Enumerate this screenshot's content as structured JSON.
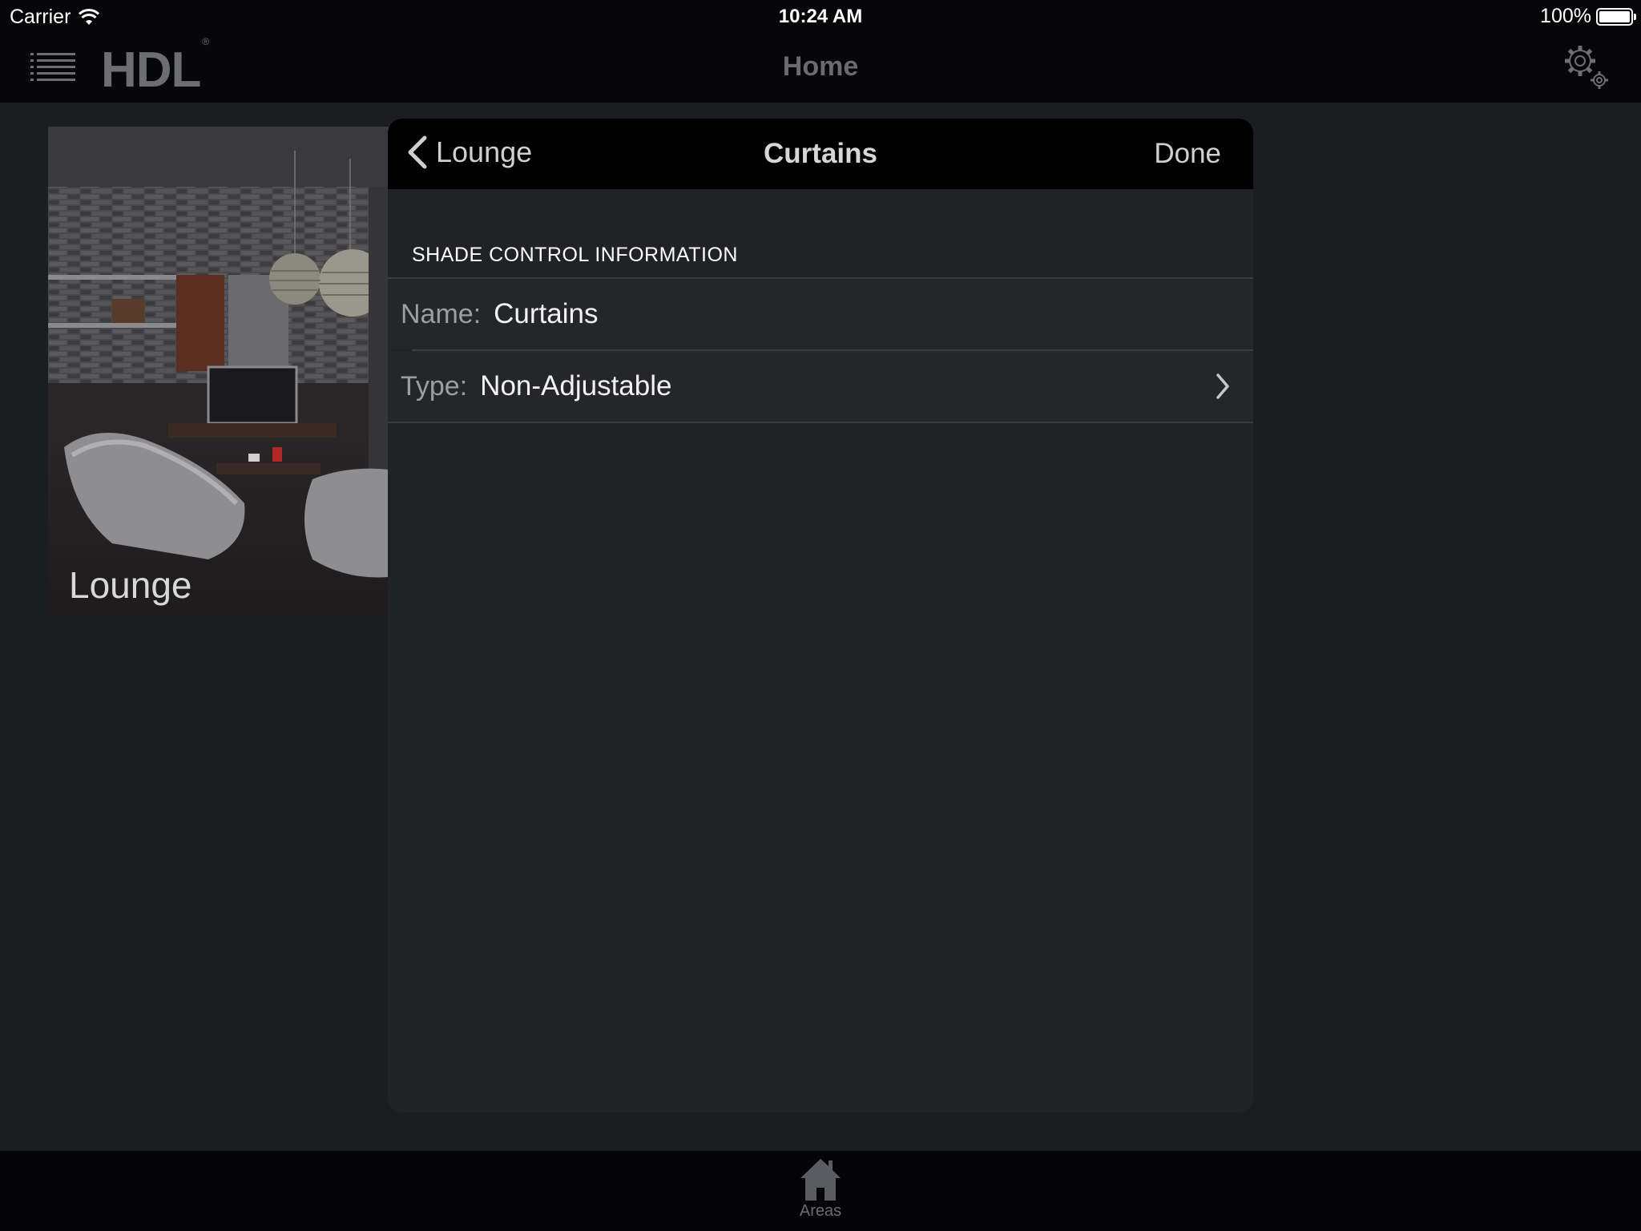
{
  "status_bar": {
    "carrier": "Carrier",
    "time": "10:24 AM",
    "battery": "100%",
    "battery_level": 1.0
  },
  "nav_bar": {
    "logo_text": "HDL",
    "logo_mark": "®",
    "title": "Home",
    "menu_icon": "list-menu-icon",
    "settings_icon": "gears-icon"
  },
  "room_tile": {
    "label": "Lounge"
  },
  "modal": {
    "back_label": "Lounge",
    "title": "Curtains",
    "done_label": "Done",
    "section_header": "SHADE CONTROL INFORMATION",
    "rows": [
      {
        "label": "Name:",
        "value": "Curtains"
      },
      {
        "label": "Type:",
        "value": "Non-Adjustable"
      }
    ]
  },
  "tab_bar": {
    "items": [
      {
        "label": "Areas",
        "icon": "home-icon"
      }
    ]
  },
  "colors": {
    "background": "#1c1d21",
    "bar": "#070709",
    "modal": "#212226",
    "modal_header": "#000000"
  }
}
